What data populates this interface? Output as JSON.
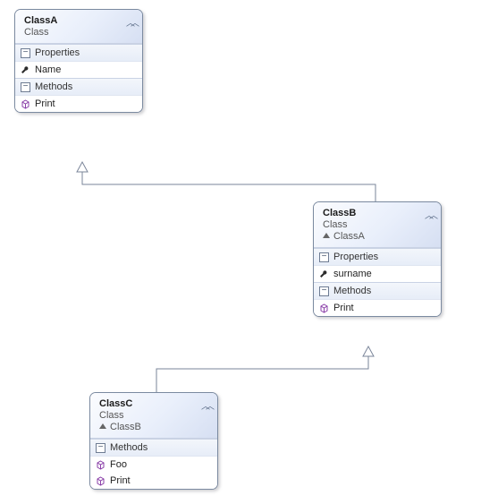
{
  "classA": {
    "name": "ClassA",
    "stereo": "Class",
    "sections": [
      {
        "label": "Properties",
        "members": [
          {
            "kind": "prop",
            "name": "Name"
          }
        ]
      },
      {
        "label": "Methods",
        "members": [
          {
            "kind": "meth",
            "name": "Print"
          }
        ]
      }
    ]
  },
  "classB": {
    "name": "ClassB",
    "stereo": "Class",
    "base": "ClassA",
    "sections": [
      {
        "label": "Properties",
        "members": [
          {
            "kind": "prop",
            "name": "surname"
          }
        ]
      },
      {
        "label": "Methods",
        "members": [
          {
            "kind": "meth",
            "name": "Print"
          }
        ]
      }
    ]
  },
  "classC": {
    "name": "ClassC",
    "stereo": "Class",
    "base": "ClassB",
    "sections": [
      {
        "label": "Methods",
        "members": [
          {
            "kind": "meth",
            "name": "Foo"
          },
          {
            "kind": "meth",
            "name": "Print"
          }
        ]
      }
    ]
  }
}
